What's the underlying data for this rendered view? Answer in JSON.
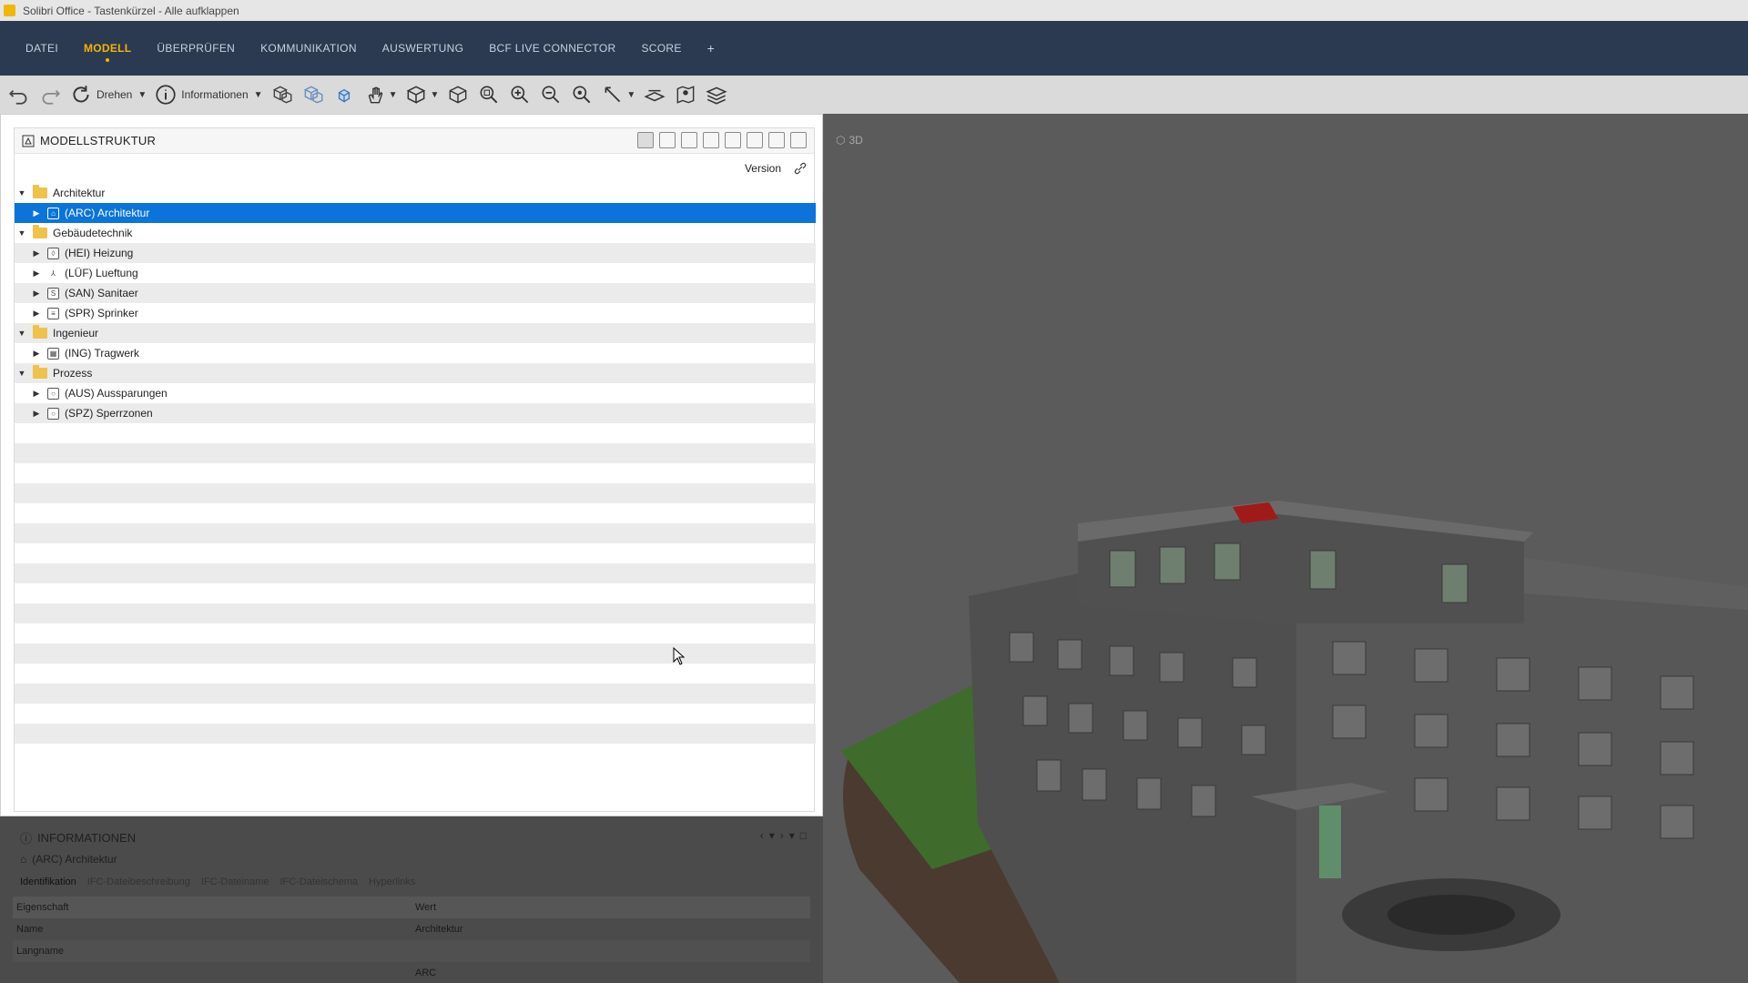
{
  "window": {
    "title": "Solibri Office - Tastenkürzel - Alle aufklappen"
  },
  "ribbon": {
    "tabs": [
      "DATEI",
      "MODELL",
      "ÜBERPRÜFEN",
      "KOMMUNIKATION",
      "AUSWERTUNG",
      "BCF LIVE CONNECTOR",
      "SCORE"
    ],
    "active_tab": "MODELL",
    "add_label": "+"
  },
  "toolbar": {
    "rotate_label": "Drehen",
    "info_label": "Informationen"
  },
  "viewport": {
    "label": "3D"
  },
  "model_structure": {
    "title": "MODELLSTRUKTUR",
    "column_version": "Version",
    "tree": [
      {
        "type": "folder",
        "label": "Architektur",
        "expanded": true
      },
      {
        "type": "model",
        "label": "(ARC) Architektur",
        "selected": true
      },
      {
        "type": "folder",
        "label": "Gebäudetechnik",
        "expanded": true
      },
      {
        "type": "model",
        "label": "(HEI) Heizung"
      },
      {
        "type": "model",
        "label": "(LÜF) Lueftung"
      },
      {
        "type": "model",
        "label": "(SAN) Sanitaer"
      },
      {
        "type": "model",
        "label": "(SPR) Sprinker"
      },
      {
        "type": "folder",
        "label": "Ingenieur",
        "expanded": true
      },
      {
        "type": "model",
        "label": "(ING) Tragwerk"
      },
      {
        "type": "folder",
        "label": "Prozess",
        "expanded": true
      },
      {
        "type": "model",
        "label": "(AUS) Aussparungen"
      },
      {
        "type": "model",
        "label": "(SPZ) Sperrzonen"
      }
    ]
  },
  "info_panel": {
    "title": "INFORMATIONEN",
    "selected": "(ARC) Architektur",
    "tabs": [
      "Identifikation",
      "IFC-Dateibeschreibung",
      "IFC-Dateiname",
      "IFC-Dateischema",
      "Hyperlinks"
    ],
    "columns": [
      "Eigenschaft",
      "Wert"
    ],
    "rows": [
      {
        "property": "Name",
        "value": "Architektur"
      },
      {
        "property": "Langname",
        "value": ""
      },
      {
        "property": "",
        "value": "ARC"
      }
    ]
  },
  "colors": {
    "ribbon_bg": "#2b3a50",
    "accent": "#f5b400",
    "selection": "#0a74da"
  }
}
